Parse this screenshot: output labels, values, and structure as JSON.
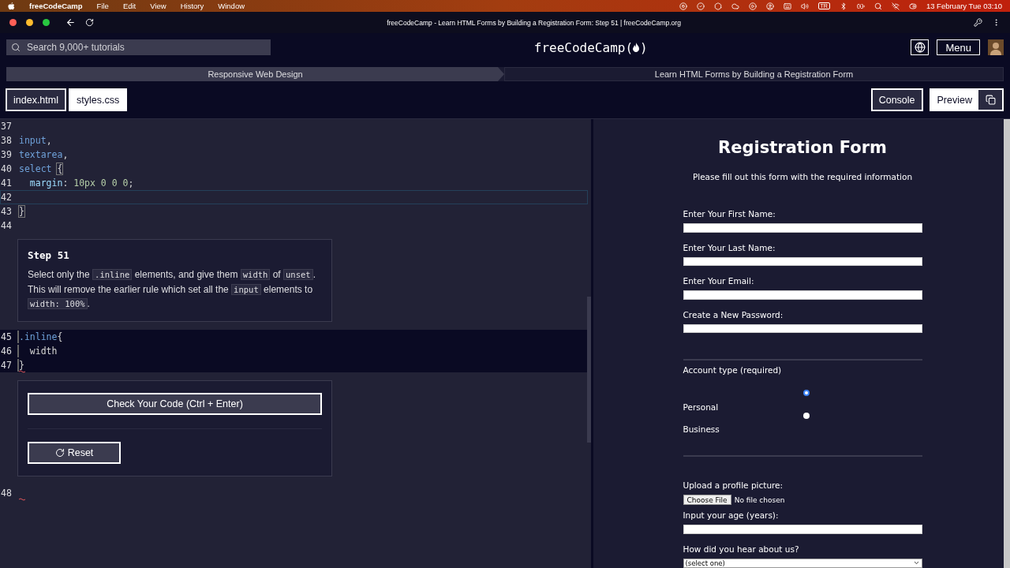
{
  "menu_bar": {
    "app": "freeCodeCamp",
    "menus": [
      "File",
      "Edit",
      "View",
      "History",
      "Window"
    ],
    "input_source": "TR",
    "clock": "13 February Tue  03:10"
  },
  "browser": {
    "title": "freeCodeCamp - Learn HTML Forms by Building a Registration Form: Step 51 | freeCodeCamp.org"
  },
  "nav": {
    "search": {
      "placeholder": "Search 9,000+ tutorials"
    },
    "logo": {
      "name": "freeCodeCamp",
      "open": "(",
      "close": ")"
    },
    "menu_button": "Menu"
  },
  "breadcrumbs": [
    {
      "label": "Responsive Web Design"
    },
    {
      "label": "Learn HTML Forms by Building a Registration Form"
    }
  ],
  "file_tabs": [
    {
      "label": "index.html",
      "selected": false
    },
    {
      "label": "styles.css",
      "selected": true
    }
  ],
  "pane_buttons": [
    {
      "label": "Console",
      "selected": false
    },
    {
      "label": "Preview",
      "selected": true
    }
  ],
  "editor": {
    "lines_before": [
      {
        "number": "37",
        "active": false,
        "error": false
      },
      {
        "number": "38",
        "active": false,
        "error": false,
        "tokens": [
          {
            "text": "input",
            "kind": "selector"
          },
          {
            "text": ",",
            "kind": "punct"
          }
        ]
      },
      {
        "number": "39",
        "active": false,
        "error": false,
        "tokens": [
          {
            "text": "textarea",
            "kind": "selector"
          },
          {
            "text": ",",
            "kind": "punct"
          }
        ]
      },
      {
        "number": "40",
        "active": false,
        "error": false,
        "tokens": [
          {
            "text": "select ",
            "kind": "selector"
          },
          {
            "text": "{",
            "kind": "bracket"
          }
        ]
      },
      {
        "number": "41",
        "active": false,
        "error": false,
        "tokens": [
          {
            "text": "  margin",
            "kind": "property"
          },
          {
            "text": ": ",
            "kind": "punct"
          },
          {
            "text": "10px 0 0 0",
            "kind": "value"
          },
          {
            "text": ";",
            "kind": "punct"
          }
        ]
      },
      {
        "number": "42",
        "active": true,
        "error": false
      },
      {
        "number": "43",
        "active": false,
        "error": false,
        "tokens": [
          {
            "text": "}",
            "kind": "bracket"
          }
        ]
      },
      {
        "number": "44",
        "active": false,
        "error": false
      }
    ],
    "step": {
      "title": "Step 51",
      "description": [
        {
          "text": "Select only the ",
          "kind": "text"
        },
        {
          "text": ".inline",
          "kind": "code"
        },
        {
          "text": " elements, and give them ",
          "kind": "text"
        },
        {
          "text": "width",
          "kind": "code"
        },
        {
          "text": " of ",
          "kind": "text"
        },
        {
          "text": "unset",
          "kind": "code"
        },
        {
          "text": ". This will remove the earlier rule which set all the ",
          "kind": "text"
        },
        {
          "text": "input",
          "kind": "code"
        },
        {
          "text": " elements to ",
          "kind": "text"
        },
        {
          "text": "width: 100%",
          "kind": "code"
        },
        {
          "text": ".",
          "kind": "text"
        }
      ]
    },
    "lines_editable": [
      {
        "number": "45",
        "active": false,
        "error": false,
        "tokens": [
          {
            "text": ".inline",
            "kind": "selector"
          },
          {
            "text": "{",
            "kind": "punct"
          }
        ]
      },
      {
        "number": "46",
        "active": false,
        "error": false,
        "tokens": [
          {
            "text": "  width",
            "kind": "plain"
          }
        ]
      },
      {
        "number": "47",
        "active": false,
        "error": true,
        "tokens": [
          {
            "text": "}",
            "kind": "punct"
          }
        ]
      }
    ],
    "check_button": "Check Your Code (Ctrl + Enter)",
    "reset_button": "Reset",
    "lines_after": [
      {
        "number": "48",
        "active": false,
        "error": true
      }
    ]
  },
  "preview": {
    "title": "Registration Form",
    "subtitle": "Please fill out this form with the required information",
    "text_fields": [
      {
        "label": "Enter Your First Name:"
      },
      {
        "label": "Enter Your Last Name:"
      },
      {
        "label": "Enter Your Email:"
      },
      {
        "label": "Create a New Password:"
      }
    ],
    "account": {
      "legend": "Account type (required)",
      "options": [
        {
          "label": "Personal",
          "selected": true
        },
        {
          "label": "Business",
          "selected": false
        }
      ]
    },
    "upload": {
      "label": "Upload a profile picture:",
      "button": "Choose File",
      "status": "No file chosen"
    },
    "age": {
      "label": "Input your age (years):"
    },
    "referrer": {
      "label": "How did you hear about us?",
      "value": "(select one)"
    }
  }
}
